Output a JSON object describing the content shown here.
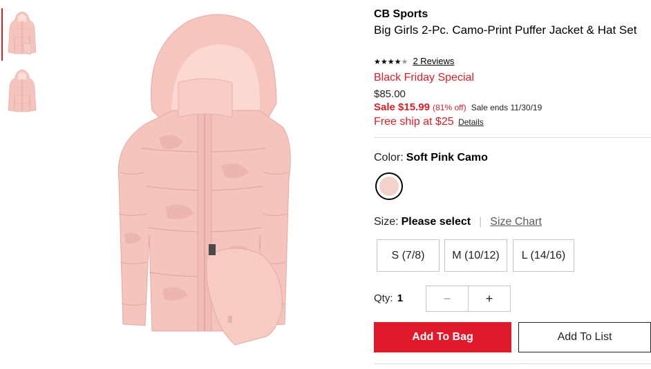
{
  "product": {
    "brand": "CB Sports",
    "title": "Big Girls 2-Pc. Camo-Print Puffer Jacket & Hat Set",
    "rating": 4,
    "rating_max": 5,
    "reviews_label": "2 Reviews",
    "promo": "Black Friday Special",
    "original_price": "$85.00",
    "sale_label": "Sale",
    "sale_price": "$15.99",
    "discount": "(81% off)",
    "sale_ends": "Sale ends 11/30/19",
    "shipping": "Free ship at $25",
    "shipping_details": "Details"
  },
  "color": {
    "label": "Color:",
    "selected": "Soft Pink Camo",
    "swatch_hex": "#f3d2cc"
  },
  "size": {
    "label": "Size:",
    "selected": "Please select",
    "size_chart": "Size Chart",
    "options": [
      "S (7/8)",
      "M (10/12)",
      "L (14/16)"
    ]
  },
  "quantity": {
    "label": "Qty:",
    "value": "1",
    "minus": "−",
    "plus": "+"
  },
  "actions": {
    "add_to_bag": "Add To Bag",
    "add_to_list": "Add To List"
  },
  "colors": {
    "accent_red": "#e11a2b",
    "sale_red": "#d81e27",
    "jacket_pink": "#f5c6c0"
  },
  "thumbnails": [
    {
      "active": true,
      "alt": "jacket with hat"
    },
    {
      "active": false,
      "alt": "jacket only"
    }
  ]
}
